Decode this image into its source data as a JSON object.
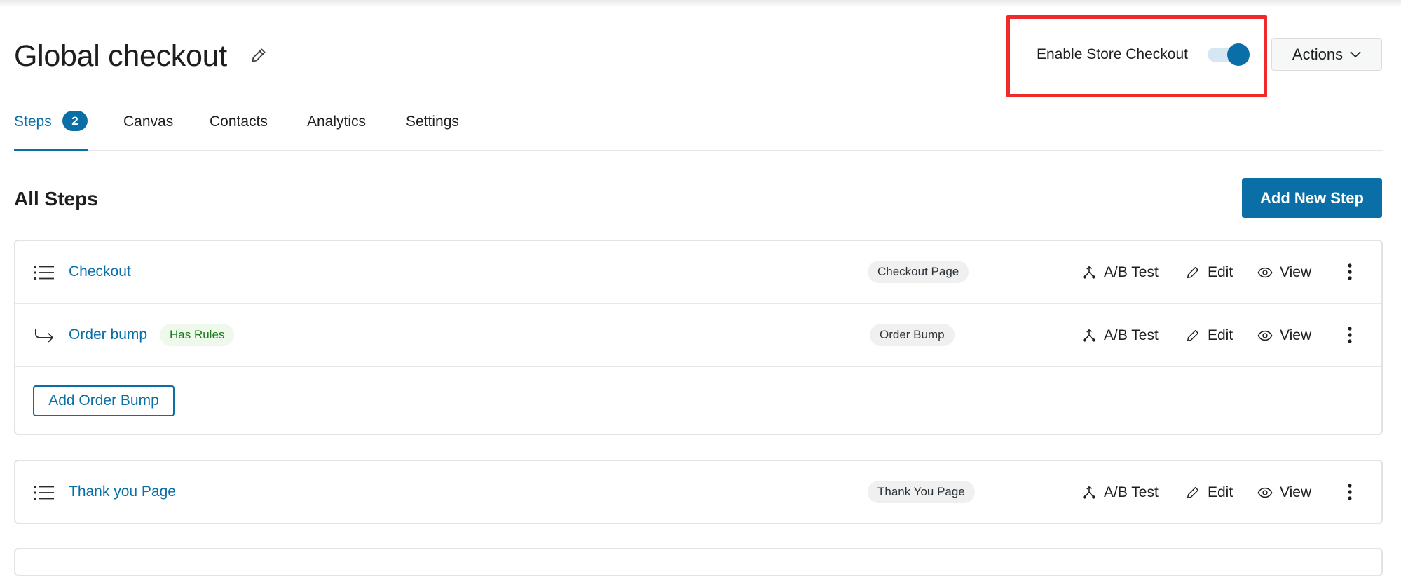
{
  "header": {
    "title": "Global checkout",
    "store_checkout_label": "Enable Store Checkout",
    "store_checkout_enabled": true,
    "actions_label": "Actions"
  },
  "tabs": [
    {
      "label": "Steps",
      "badge": "2",
      "active": true
    },
    {
      "label": "Canvas"
    },
    {
      "label": "Contacts"
    },
    {
      "label": "Analytics"
    },
    {
      "label": "Settings"
    }
  ],
  "section": {
    "title": "All Steps",
    "add_step_label": "Add New Step"
  },
  "steps": [
    {
      "name": "Checkout",
      "type": "Checkout Page",
      "icon": "list-icon",
      "actions": [
        "A/B Test",
        "Edit",
        "View"
      ]
    },
    {
      "name": "Order bump",
      "badge": "Has Rules",
      "type": "Order Bump",
      "icon": "arrow-turn-right-icon",
      "actions": [
        "A/B Test",
        "Edit",
        "View"
      ]
    },
    {
      "name": "Thank you Page",
      "type": "Thank You Page",
      "icon": "list-icon",
      "actions": [
        "A/B Test",
        "Edit",
        "View"
      ]
    }
  ],
  "add_order_bump_label": "Add Order Bump",
  "colors": {
    "accent": "#0a6fa7",
    "highlight": "#ef2a2a",
    "rules_badge_text": "#1d7a1d",
    "rules_badge_bg": "#eef9ec"
  }
}
